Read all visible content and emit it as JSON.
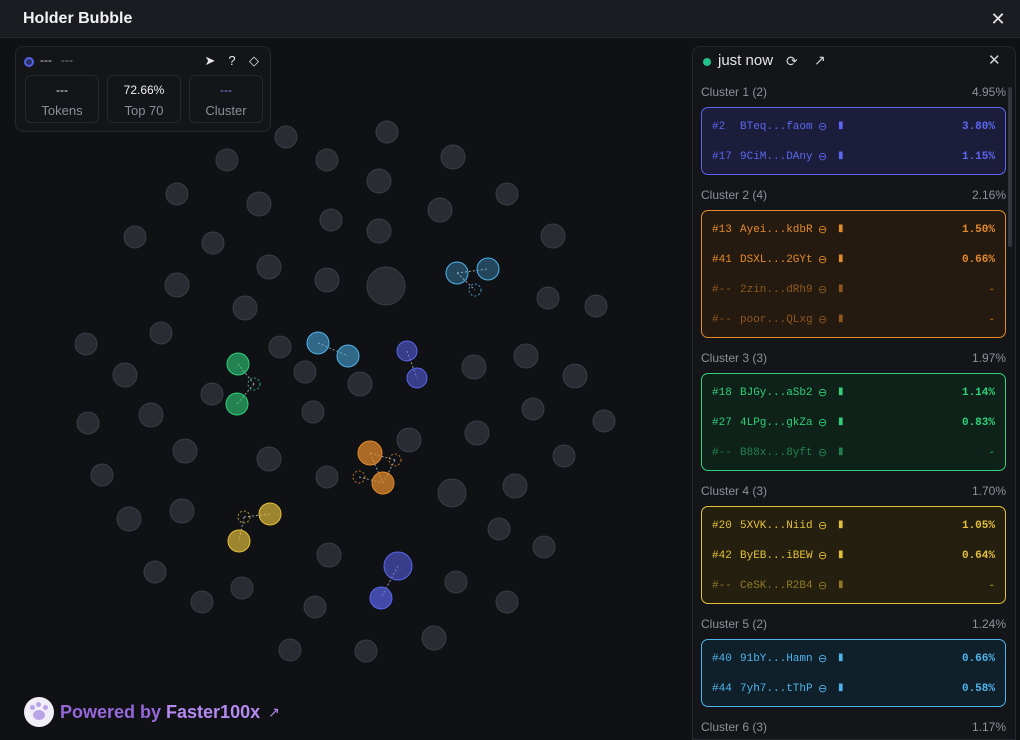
{
  "window": {
    "title": "Holder Bubble",
    "close": "✕"
  },
  "info": {
    "name": "---",
    "address": "---",
    "icons": [
      "telegram-icon",
      "help-icon",
      "tag-icon"
    ],
    "stats": [
      {
        "value": "---",
        "label": "Tokens"
      },
      {
        "value": "72.66%",
        "label": "Top 70"
      },
      {
        "value": "---",
        "label": "Cluster"
      }
    ]
  },
  "powered": {
    "prefix": "Powered by ",
    "brand": "Faster100x"
  },
  "panel": {
    "updated": "just now",
    "clusters": [
      {
        "title": "Cluster 1 (2)",
        "percent": "4.95%",
        "color": "#5b67f0",
        "bg": "#1b1d3a",
        "rows": [
          {
            "rank": "#2",
            "address": "BTeq...faom",
            "percent": "3.80%",
            "dim": false
          },
          {
            "rank": "#17",
            "address": "9CiM...DAny",
            "percent": "1.15%",
            "dim": false
          }
        ]
      },
      {
        "title": "Cluster 2 (4)",
        "percent": "2.16%",
        "color": "#e38a2b",
        "bg": "#251a10",
        "rows": [
          {
            "rank": "#13",
            "address": "Ayei...kdbR",
            "percent": "1.50%",
            "dim": false
          },
          {
            "rank": "#41",
            "address": "DSXL...2GYt",
            "percent": "0.66%",
            "dim": false
          },
          {
            "rank": "#--",
            "address": "2zin...dRh9",
            "percent": "-",
            "dim": true
          },
          {
            "rank": "#--",
            "address": "poor...QLxg",
            "percent": "-",
            "dim": true
          }
        ]
      },
      {
        "title": "Cluster 3 (3)",
        "percent": "1.97%",
        "color": "#2fd07a",
        "bg": "#0f2219",
        "rows": [
          {
            "rank": "#18",
            "address": "BJGy...aSb2",
            "percent": "1.14%",
            "dim": false
          },
          {
            "rank": "#27",
            "address": "4LPg...gkZa",
            "percent": "0.83%",
            "dim": false
          },
          {
            "rank": "#--",
            "address": "B88x...8yft",
            "percent": "-",
            "dim": true
          }
        ]
      },
      {
        "title": "Cluster 4 (3)",
        "percent": "1.70%",
        "color": "#e3c03a",
        "bg": "#241f0f",
        "rows": [
          {
            "rank": "#20",
            "address": "5XVK...Niid",
            "percent": "1.05%",
            "dim": false
          },
          {
            "rank": "#42",
            "address": "ByEB...iBEW",
            "percent": "0.64%",
            "dim": false
          },
          {
            "rank": "#--",
            "address": "CeSK...R2B4",
            "percent": "-",
            "dim": true
          }
        ]
      },
      {
        "title": "Cluster 5 (2)",
        "percent": "1.24%",
        "color": "#4fb4ec",
        "bg": "#10202b",
        "rows": [
          {
            "rank": "#40",
            "address": "91bY...Hamn",
            "percent": "0.66%",
            "dim": false
          },
          {
            "rank": "#44",
            "address": "7yh7...tThP",
            "percent": "0.58%",
            "dim": false
          }
        ]
      },
      {
        "title": "Cluster 6 (3)",
        "percent": "1.17%",
        "color": "#8d919a",
        "bg": "#141519",
        "rows": []
      }
    ]
  }
}
